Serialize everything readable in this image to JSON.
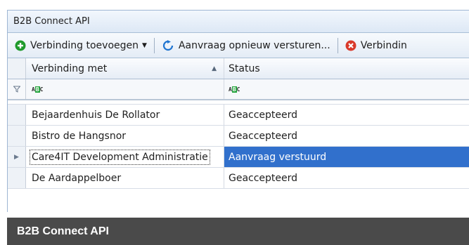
{
  "window": {
    "title": "B2B Connect API"
  },
  "toolbar": {
    "add_label": "Verbinding toevoegen",
    "resend_label": "Aanvraag opnieuw versturen...",
    "delete_label": "Verbindin"
  },
  "table": {
    "columns": [
      "Verbinding met",
      "Status"
    ],
    "filter_hint": "ABC",
    "rows": [
      {
        "name": "Bejaardenhuis De Rollator",
        "status": "Geaccepteerd"
      },
      {
        "name": "Bistro de Hangsnor",
        "status": "Geaccepteerd"
      },
      {
        "name": "Care4IT Development Administratie",
        "status": "Aanvraag verstuurd"
      },
      {
        "name": "De Aardappelboer",
        "status": "Geaccepteerd"
      }
    ],
    "selected_index": 2
  },
  "footer": {
    "caption": "B2B Connect API"
  },
  "colors": {
    "selection": "#3170cc",
    "add_icon": "#1f9a2c",
    "delete_icon": "#d93a2b",
    "refresh_icon": "#1f74d0"
  },
  "icons": {
    "add": "plus-circle-icon",
    "resend": "refresh-icon",
    "delete": "x-circle-icon",
    "filter": "filter-icon",
    "sort": "sort-ascending-icon"
  }
}
